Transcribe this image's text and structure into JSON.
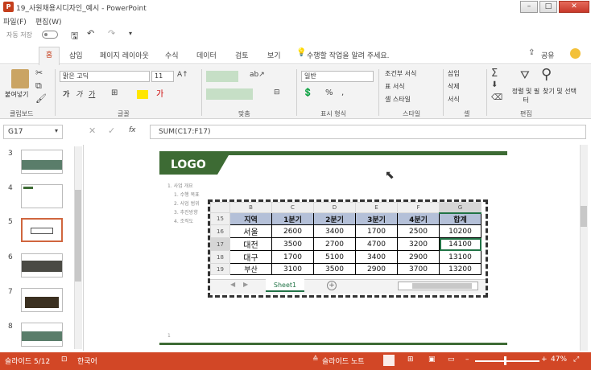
{
  "window": {
    "title": "19_사원채용시디자인_예시 - PowerPoint",
    "app_icon": "P"
  },
  "menu": {
    "file": "파일(F)",
    "view": "편집(W)"
  },
  "qat": {
    "autosave": "자동 저장",
    "autosave_state": "끔"
  },
  "tabs": [
    "홈",
    "삽입",
    "페이지 레이아웃",
    "수식",
    "데이터",
    "검토",
    "보기"
  ],
  "tellme": "수행할 작업을 알려 주세요.",
  "share": "공유",
  "ribbon": {
    "clipboard_label": "클립보드",
    "paste": "붙여넣기",
    "font_name": "맑은 고딕",
    "font_size": "11",
    "font_label": "글꼴",
    "align_label": "맞춤",
    "number_format": "일반",
    "number_label": "표시 형식",
    "cond_format": "조건부 서식",
    "table_format": "표 서식",
    "cell_style": "셀 스타일",
    "style_label": "스타일",
    "insert": "삽입",
    "delete": "삭제",
    "format": "서식",
    "cell_label": "셀",
    "sort_filter": "정렬 및 필터",
    "find_select": "찾기 및 선택",
    "edit_label": "편집"
  },
  "formula": {
    "namebox": "G17",
    "text": "SUM(C17:F17)"
  },
  "thumbnails": [
    {
      "num": "3"
    },
    {
      "num": "4"
    },
    {
      "num": "5"
    },
    {
      "num": "6"
    },
    {
      "num": "7"
    },
    {
      "num": "8"
    }
  ],
  "slide": {
    "logo": "LOGO",
    "bullets": [
      "1. 사업 개요",
      "1. 수행 목표",
      "2. 사업 범위",
      "3. 추진방향",
      "4. 조직도"
    ]
  },
  "sheet": {
    "col_headers": [
      "B",
      "C",
      "D",
      "E",
      "F",
      "G"
    ],
    "rows": [
      {
        "rownum": "15",
        "cells": [
          "지역",
          "1분기",
          "2분기",
          "3분기",
          "4분기",
          "합계"
        ]
      },
      {
        "rownum": "16",
        "cells": [
          "서울",
          "2600",
          "3400",
          "1700",
          "2500",
          "10200"
        ]
      },
      {
        "rownum": "17",
        "cells": [
          "대전",
          "3500",
          "2700",
          "4700",
          "3200",
          "14100"
        ]
      },
      {
        "rownum": "18",
        "cells": [
          "대구",
          "1700",
          "5100",
          "3400",
          "2900",
          "13100"
        ]
      },
      {
        "rownum": "19",
        "cells": [
          "부산",
          "3100",
          "3500",
          "2900",
          "3700",
          "13200"
        ]
      }
    ],
    "tab": "Sheet1"
  },
  "status": {
    "slide_info": "슬라이드 5/12",
    "language": "한국어",
    "notes": "슬라이드 노트",
    "zoom": "47%"
  }
}
